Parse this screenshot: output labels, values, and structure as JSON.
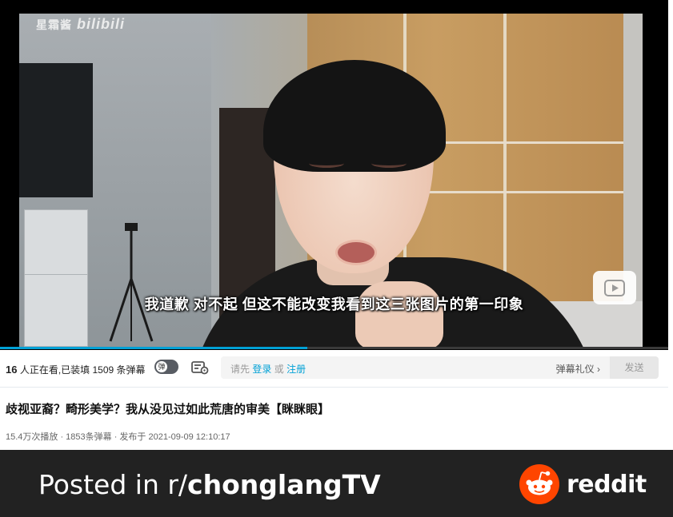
{
  "video": {
    "watermark_creator": "星霜酱",
    "watermark_brand": "bilibili",
    "subtitle": "我道歉 对不起 但这不能改变我看到这三张图片的第一印象",
    "progress_fraction": 0.46
  },
  "danmaku": {
    "viewers": "16",
    "viewers_suffix": "人正在看,已装填",
    "loaded_count": "1509",
    "loaded_suffix": "条弹幕",
    "toggle_label": "弹",
    "prompt_prefix": "请先",
    "login_label": "登录",
    "or_label": "或",
    "register_label": "注册",
    "etiquette_label": "弹幕礼仪 ›",
    "send_label": "发送"
  },
  "title": "歧视亚裔？畸形美学？我从没见过如此荒唐的审美【眯眯眼】",
  "meta": "15.4万次播放 · 1853条弹幕 · 发布于 2021-09-09 12:10:17",
  "banner": {
    "posted_prefix": "Posted in r/",
    "subreddit": "chonglangTV",
    "reddit_wordmark": "reddit",
    "reddit_color": "#ff4500"
  }
}
